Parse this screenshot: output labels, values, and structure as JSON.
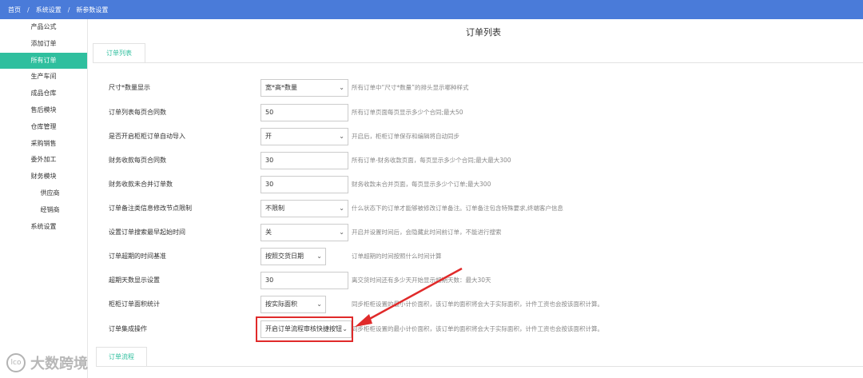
{
  "breadcrumb": {
    "items": [
      "首页",
      "系统设置",
      "新参数设置"
    ],
    "separator": "/"
  },
  "sidebar": {
    "items": [
      {
        "label": "产品公式",
        "active": false,
        "indent": false
      },
      {
        "label": "添加订单",
        "active": false,
        "indent": false
      },
      {
        "label": "所有订单",
        "active": true,
        "indent": false
      },
      {
        "label": "生产车间",
        "active": false,
        "indent": false
      },
      {
        "label": "成品仓库",
        "active": false,
        "indent": false
      },
      {
        "label": "售后模块",
        "active": false,
        "indent": false
      },
      {
        "label": "仓库管理",
        "active": false,
        "indent": false
      },
      {
        "label": "采购销售",
        "active": false,
        "indent": false
      },
      {
        "label": "委外加工",
        "active": false,
        "indent": false
      },
      {
        "label": "财务模块",
        "active": false,
        "indent": false
      },
      {
        "label": "供应商",
        "active": false,
        "indent": true
      },
      {
        "label": "经销商",
        "active": false,
        "indent": true
      },
      {
        "label": "系统设置",
        "active": false,
        "indent": false
      }
    ]
  },
  "page": {
    "title": "订单列表",
    "tab": "订单列表",
    "bottom_tab": "订单流程"
  },
  "settings": [
    {
      "label": "尺寸*数量显示",
      "type": "select",
      "value": "宽*高*数量",
      "hint": "所有订单中“尺寸*数量”的排头显示哪种样式"
    },
    {
      "label": "订单列表每页合同数",
      "type": "input",
      "value": "50",
      "hint": "所有订单页面每页显示多少个合同;最大50"
    },
    {
      "label": "是否开启柜柜订单自动导入",
      "type": "select",
      "value": "开",
      "hint": "开启后，柜柜订单保存和编辑将自动同步"
    },
    {
      "label": "财务收款每页合同数",
      "type": "input",
      "value": "30",
      "hint": "所有订单-财务收款页面，每页显示多少个合同;最大最大300"
    },
    {
      "label": "财务收款未合并订单数",
      "type": "input",
      "value": "30",
      "hint": "财务收款未合并页面，每页显示多少个订单;最大300"
    },
    {
      "label": "订单备注类信息修改节点限制",
      "type": "select",
      "value": "不限制",
      "hint": "什么状态下的订单才能够被修改订单备注。订单备注包含特殊要求,终端客户信息"
    },
    {
      "label": "设置订单搜索最早起始时间",
      "type": "select",
      "value": "关",
      "hint": "开启并设置时间后，会隐藏此时间前订单，不能进行搜索"
    },
    {
      "label": "订单超期的时间基准",
      "type": "select",
      "value": "按照交货日期",
      "hint": "订单超期的时间按照什么时间计算"
    },
    {
      "label": "超期天数显示设置",
      "type": "input",
      "value": "30",
      "hint": "离交货时间还有多少天开始显示超期天数：最大30天"
    },
    {
      "label": "柜柜订单面积统计",
      "type": "select",
      "value": "按实际面积",
      "hint": "同步柜柜设置的最小计价面积，该订单的面积将会大于实际面积，计件工资也会按该面积计算。"
    },
    {
      "label": "订单集成操作",
      "type": "select",
      "value": "开启订单流程审核快捷按钮",
      "hint": "同步柜柜设置的最小计价面积，该订单的面积将会大于实际面积，计件工资也会按该面积计算。"
    }
  ],
  "watermark": {
    "logo_text": "lco",
    "text": "大数跨境"
  },
  "colors": {
    "topbar": "#4a7bd9",
    "accent": "#2fbf9e",
    "annotation": "#e02a2a"
  }
}
